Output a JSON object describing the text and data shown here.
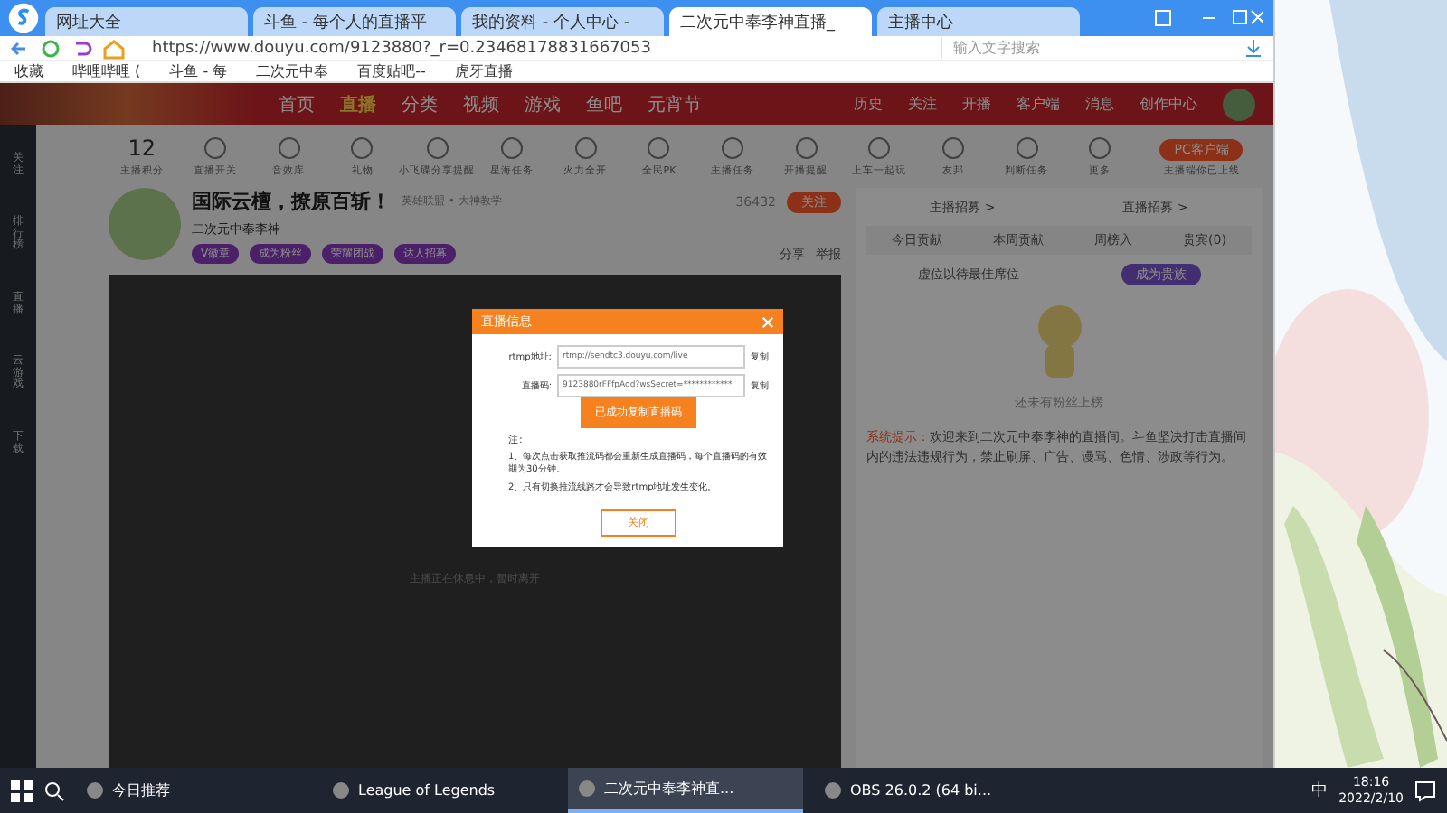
{
  "browser": {
    "tabs": [
      {
        "label": "网址大全",
        "selected": false
      },
      {
        "label": "斗鱼 - 每个人的直播平",
        "selected": false
      },
      {
        "label": "我的资料 - 个人中心 -",
        "selected": false
      },
      {
        "label": "二次元中奉李神直播_",
        "selected": true
      },
      {
        "label": "主播中心",
        "selected": false
      }
    ],
    "url": "https://www.douyu.com/9123880?_r=0.23468178831667053",
    "search": {
      "placeholder": "输入文字搜索"
    },
    "bookmarks": [
      "收藏",
      "哔哩哔哩 (",
      "斗鱼 - 每",
      "二次元中奉",
      "百度贴吧--",
      "虎牙直播"
    ]
  },
  "site": {
    "nav": [
      {
        "label": "首页",
        "selected": false
      },
      {
        "label": "直播",
        "selected": true
      },
      {
        "label": "分类",
        "selected": false
      },
      {
        "label": "视频",
        "selected": false
      },
      {
        "label": "游戏",
        "selected": false
      },
      {
        "label": "鱼吧",
        "selected": false
      },
      {
        "label": "元宵节",
        "selected": false
      }
    ],
    "user_links": [
      "历史",
      "关注",
      "开播",
      "客户端",
      "消息",
      "创作中心"
    ],
    "sidebar": [
      "关注",
      "排行榜",
      "直播",
      "云游戏",
      "下载"
    ],
    "score": {
      "value": "12",
      "label": "主播积分"
    },
    "tools": [
      "直播开关",
      "音效库",
      "礼物",
      "小飞碟分享提醒",
      "星海任务",
      "火力全开",
      "全民PK",
      "主播任务",
      "开播提醒",
      "上车一起玩",
      "友邦",
      "判断任务",
      "更多"
    ],
    "client_button": "PC客户端",
    "client_note": "主播端你已上线",
    "room": {
      "title": "国际云檀，撩原百斩！",
      "category": "英雄联盟 • 大神教学",
      "streamer": "二次元中奉李神",
      "follow_count": "36432",
      "follow": "关注",
      "badges": [
        "V徽章",
        "成为粉丝",
        "荣耀团战",
        "达人招募"
      ],
      "share": "分享",
      "report": "举报"
    },
    "player_note": "主播正在休息中，暂时离开",
    "rank": {
      "links": [
        "主播招募 >",
        "直播招募 >"
      ],
      "tabs": [
        "今日贡献",
        "本周贡献",
        "周榜入",
        "贵宾(0)"
      ],
      "hint": "虚位以待最佳席位",
      "noble": "成为贵族",
      "empty": "还未有粉丝上榜",
      "notice_label": "系统提示：",
      "notice": "欢迎来到二次元中奉李神的直播间。斗鱼坚决打击直播间内的违法违规行为，禁止刷屏、广告、谩骂、色情、涉政等行为。"
    }
  },
  "dialog": {
    "title": "直播信息",
    "rtmp_label": "rtmp地址:",
    "rtmp_value": "rtmp://sendtc3.douyu.com/live",
    "code_label": "直播码:",
    "code_value": "9123880rFFfpAdd?wsSecret=************",
    "copy": [
      "复制",
      "复制"
    ],
    "toast": "已成功复制直播码",
    "note_title": "注:",
    "notes": [
      "1、每次点击获取推流码都会重新生成直播码，每个直播码的有效期为30分钟。",
      "2、只有切换推流线路才会导致rtmp地址发生变化。"
    ],
    "close": "关闭"
  },
  "taskbar": {
    "apps": [
      {
        "label": "今日推荐",
        "selected": false
      },
      {
        "label": "League of Legends",
        "selected": false
      },
      {
        "label": "二次元中奉李神直...",
        "selected": true
      },
      {
        "label": "OBS 26.0.2 (64 bi...",
        "selected": false
      }
    ],
    "ime": "中",
    "time": "18:16",
    "date": "2022/2/10"
  }
}
